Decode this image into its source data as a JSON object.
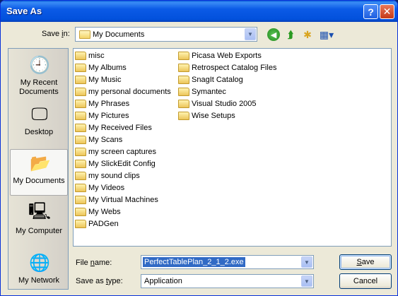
{
  "window": {
    "title": "Save As",
    "help_glyph": "?",
    "close_glyph": "✕"
  },
  "save_in": {
    "label_pre": "Save ",
    "label_key": "i",
    "label_post": "n:",
    "value": "My Documents",
    "icons": [
      "back-icon",
      "up-folder-icon",
      "new-folder-icon",
      "views-menu-icon"
    ]
  },
  "places": [
    {
      "label": "My Recent Documents",
      "icon": "recent-documents-icon"
    },
    {
      "label": "Desktop",
      "icon": "desktop-icon"
    },
    {
      "label": "My Documents",
      "icon": "my-documents-icon",
      "selected": true
    },
    {
      "label": "My Computer",
      "icon": "my-computer-icon"
    },
    {
      "label": "My Network",
      "icon": "my-network-icon"
    }
  ],
  "files_col1": [
    "misc",
    "My Albums",
    "My Music",
    "my personal documents",
    "My Phrases",
    "My Pictures",
    "My Received Files",
    "My Scans",
    "my screen captures",
    "My SlickEdit Config",
    "my sound clips",
    "My Videos",
    "My Virtual Machines",
    "My Webs",
    "PADGen"
  ],
  "files_col2": [
    "Picasa Web Exports",
    "Retrospect Catalog Files",
    "SnagIt Catalog",
    "Symantec",
    "Visual Studio 2005",
    "Wise Setups"
  ],
  "file_name": {
    "label_pre": "File ",
    "label_key": "n",
    "label_post": "ame:",
    "value": "PerfectTablePlan_2_1_2.exe"
  },
  "save_as_type": {
    "label_pre": "Save as ",
    "label_key": "t",
    "label_post": "ype:",
    "value": "Application"
  },
  "buttons": {
    "save_key": "S",
    "save_rest": "ave",
    "cancel": "Cancel"
  },
  "colors": {
    "titlebar": "#0251dc",
    "selection": "#316ac5",
    "face": "#ece9d8"
  }
}
